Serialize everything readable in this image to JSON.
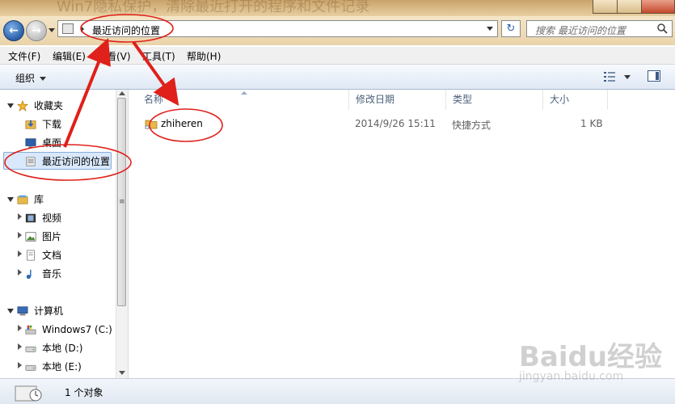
{
  "window": {
    "title_ghost": "Win7隐私保护，清除最近打开的程序和文件记录"
  },
  "navigation": {
    "back_icon": "back-arrow-icon",
    "forward_icon": "forward-arrow-icon",
    "address_path": "最近访问的位置",
    "refresh_glyph": "↻",
    "search_placeholder": "搜索 最近访问的位置"
  },
  "menu": {
    "items": [
      "文件(F)",
      "编辑(E)",
      "查看(V)",
      "工具(T)",
      "帮助(H)"
    ]
  },
  "toolbar": {
    "organize_label": "组织"
  },
  "sidebar": {
    "favorites": {
      "label": "收藏夹",
      "items": [
        "下载",
        "桌面",
        "最近访问的位置"
      ]
    },
    "libraries": {
      "label": "库",
      "items": [
        "视频",
        "图片",
        "文档",
        "音乐"
      ]
    },
    "computer": {
      "label": "计算机",
      "items": [
        "Windows7 (C:)",
        "本地 (D:)",
        "本地 (E:)"
      ]
    },
    "selected": "最近访问的位置"
  },
  "files": {
    "columns": [
      "名称",
      "修改日期",
      "类型",
      "大小"
    ],
    "rows": [
      {
        "name": "zhiheren",
        "date": "2014/9/26 15:11",
        "type": "快捷方式",
        "size": "1 KB"
      }
    ]
  },
  "status": {
    "count_text": "1 个对象"
  },
  "watermark": {
    "brand": "Baidu经验",
    "domain": "jingyan.baidu.com"
  },
  "colors": {
    "annotation_red": "#e0201a",
    "selection_fill": "#d9e8fb",
    "folder_yellow": "#e8b84a"
  }
}
